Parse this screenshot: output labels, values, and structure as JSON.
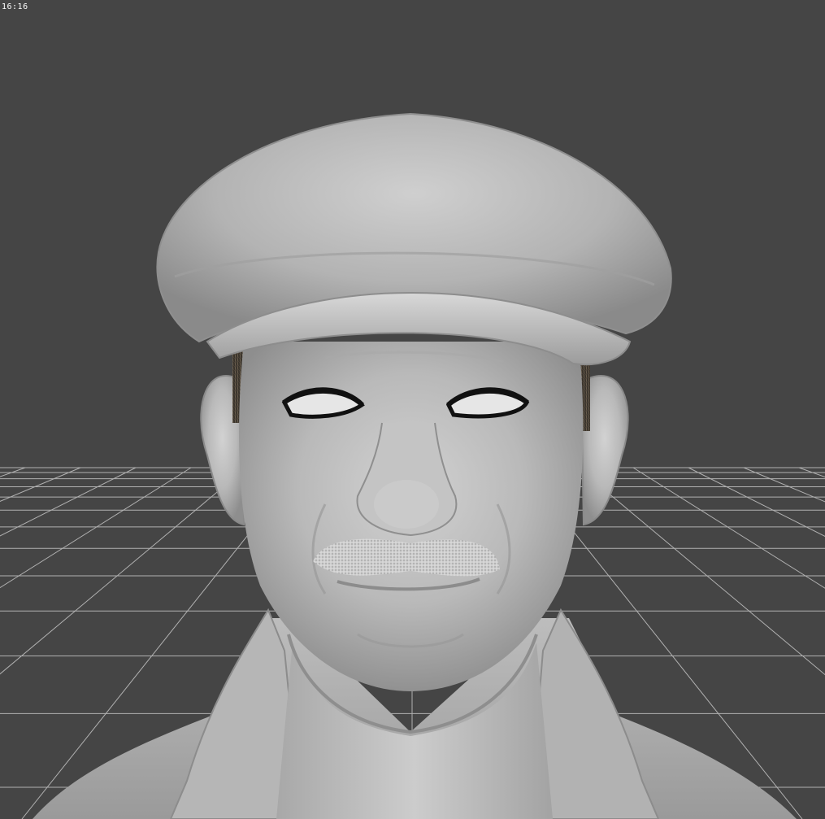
{
  "hud": {
    "timestamp": "16:16"
  },
  "viewport": {
    "background_color": "#454545",
    "grid_line_color": "#bdbdbd",
    "grid": true
  },
  "model": {
    "material_color": "#b8b8b8",
    "parts": [
      "flat-cap",
      "head",
      "ears",
      "eyes",
      "nose",
      "mustache",
      "mouth",
      "neck",
      "collar",
      "jacket"
    ]
  },
  "icons": {
    "cap": "flat-cap-shape",
    "hair": "sideburn-texture"
  }
}
